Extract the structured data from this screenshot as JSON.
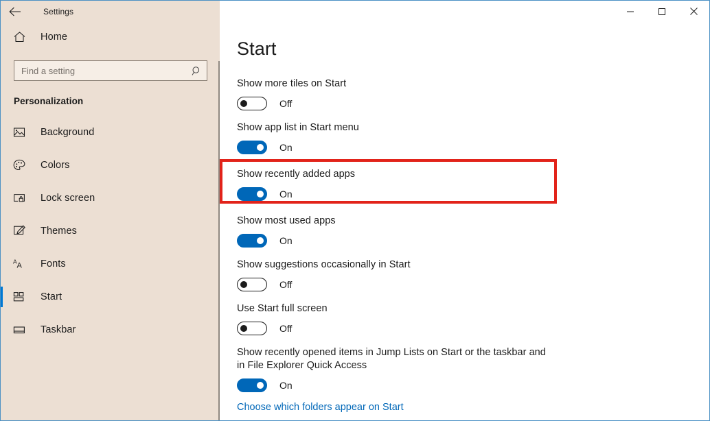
{
  "window": {
    "app_title": "Settings",
    "back_icon": "back-arrow-icon",
    "minimize_label": "–",
    "maximize_label": "□",
    "close_label": "✕",
    "accent_color": "#0067b8",
    "sidebar_color": "#ecdfd3",
    "annotation_color": "#e2231a"
  },
  "sidebar": {
    "home_label": "Home",
    "home_icon": "home-icon",
    "search": {
      "placeholder": "Find a setting",
      "value": "",
      "icon": "search-icon"
    },
    "section_title": "Personalization",
    "items": [
      {
        "label": "Background",
        "icon": "picture-icon",
        "selected": false
      },
      {
        "label": "Colors",
        "icon": "palette-icon",
        "selected": false
      },
      {
        "label": "Lock screen",
        "icon": "lock-screen-icon",
        "selected": false
      },
      {
        "label": "Themes",
        "icon": "brush-icon",
        "selected": false
      },
      {
        "label": "Fonts",
        "icon": "fonts-aa-icon",
        "selected": false
      },
      {
        "label": "Start",
        "icon": "start-tiles-icon",
        "selected": true
      },
      {
        "label": "Taskbar",
        "icon": "taskbar-icon",
        "selected": false
      }
    ]
  },
  "main": {
    "page_title": "Start",
    "settings": [
      {
        "label": "Show more tiles on Start",
        "state": "Off",
        "on": false
      },
      {
        "label": "Show app list in Start menu",
        "state": "On",
        "on": true
      },
      {
        "label": "Show recently added apps",
        "state": "On",
        "on": true
      },
      {
        "label": "Show most used apps",
        "state": "On",
        "on": true
      },
      {
        "label": "Show suggestions occasionally in Start",
        "state": "Off",
        "on": false
      },
      {
        "label": "Use Start full screen",
        "state": "Off",
        "on": false
      },
      {
        "label": "Show recently opened items in Jump Lists on Start or the taskbar and in File Explorer Quick Access",
        "state": "On",
        "on": true
      }
    ],
    "link_label": "Choose which folders appear on Start"
  }
}
